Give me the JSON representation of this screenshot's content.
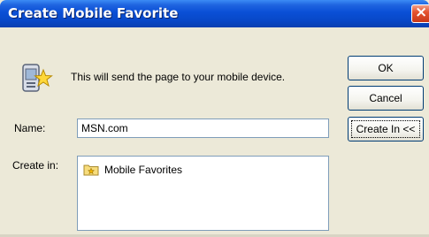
{
  "dialog": {
    "title": "Create Mobile Favorite",
    "close_glyph": "×",
    "message": "This will send the page to your mobile device.",
    "icon": "mobile-favorite-icon"
  },
  "buttons": {
    "ok": "OK",
    "cancel": "Cancel",
    "create_in": "Create In <<"
  },
  "form": {
    "name_label": "Name:",
    "name_value": "MSN.com",
    "create_in_label": "Create in:"
  },
  "tree": {
    "items": [
      {
        "label": "Mobile Favorites",
        "icon": "favorites-folder-icon"
      }
    ]
  }
}
